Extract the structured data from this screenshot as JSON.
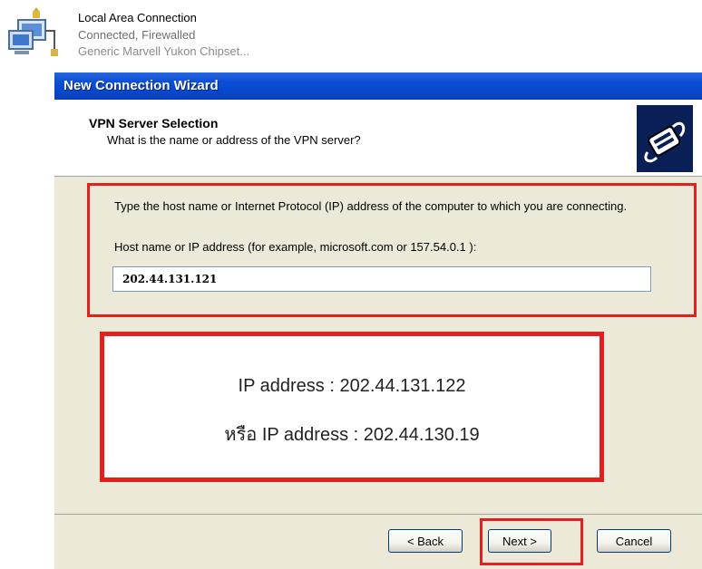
{
  "connection": {
    "name": "Local Area Connection",
    "status": "Connected, Firewalled",
    "device": "Generic Marvell Yukon Chipset..."
  },
  "wizard": {
    "title": "New Connection Wizard",
    "header_title": "VPN Server Selection",
    "header_subtitle": "What is the name or address of the VPN server?",
    "instructions": "Type the host name or Internet Protocol (IP) address of the computer to which you are connecting.",
    "host_label": "Host name or IP address (for example, microsoft.com or 157.54.0.1 ):",
    "host_value": "202.44.131.121",
    "buttons": {
      "back": "< Back",
      "next": "Next >",
      "cancel": "Cancel"
    }
  },
  "annotation": {
    "line1": "IP address : 202.44.131.122",
    "line2": "หรือ IP address : 202.44.130.19"
  },
  "colors": {
    "highlight": "#e4201e",
    "titlebar": "#0a4fd6",
    "dialog_bg": "#ece9d8"
  }
}
